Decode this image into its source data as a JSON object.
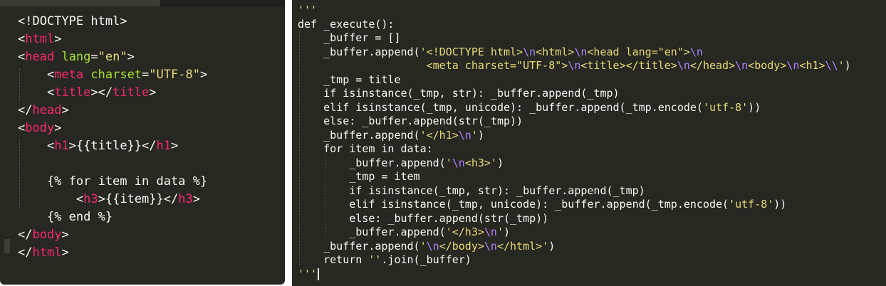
{
  "left_editor": {
    "lines": [
      [
        {
          "c": "p",
          "t": "<!DOCTYPE html>"
        }
      ],
      [
        {
          "c": "p",
          "t": "<"
        },
        {
          "c": "t",
          "t": "html"
        },
        {
          "c": "p",
          "t": ">"
        }
      ],
      [
        {
          "c": "p",
          "t": "<"
        },
        {
          "c": "t",
          "t": "head"
        },
        {
          "c": "p",
          "t": " "
        },
        {
          "c": "a",
          "t": "lang"
        },
        {
          "c": "p",
          "t": "="
        },
        {
          "c": "s",
          "t": "\"en\""
        },
        {
          "c": "p",
          "t": ">"
        }
      ],
      [
        {
          "c": "p",
          "t": "    <"
        },
        {
          "c": "t",
          "t": "meta"
        },
        {
          "c": "p",
          "t": " "
        },
        {
          "c": "a",
          "t": "charset"
        },
        {
          "c": "p",
          "t": "="
        },
        {
          "c": "s",
          "t": "\"UTF-8\""
        },
        {
          "c": "p",
          "t": ">"
        }
      ],
      [
        {
          "c": "p",
          "t": "    <"
        },
        {
          "c": "t",
          "t": "title"
        },
        {
          "c": "p",
          "t": "></"
        },
        {
          "c": "t",
          "t": "title"
        },
        {
          "c": "p",
          "t": ">"
        }
      ],
      [
        {
          "c": "p",
          "t": "</"
        },
        {
          "c": "t",
          "t": "head"
        },
        {
          "c": "p",
          "t": ">"
        }
      ],
      [
        {
          "c": "p",
          "t": "<"
        },
        {
          "c": "t",
          "t": "body"
        },
        {
          "c": "p",
          "t": ">"
        }
      ],
      [
        {
          "c": "p",
          "t": "    <"
        },
        {
          "c": "t",
          "t": "h1"
        },
        {
          "c": "p",
          "t": ">{{title}}</"
        },
        {
          "c": "t",
          "t": "h1"
        },
        {
          "c": "p",
          "t": ">"
        }
      ],
      [
        {
          "c": "p",
          "t": ""
        }
      ],
      [
        {
          "c": "p",
          "t": "    {% for item in data %}"
        }
      ],
      [
        {
          "c": "p",
          "t": "        <"
        },
        {
          "c": "t",
          "t": "h3"
        },
        {
          "c": "p",
          "t": ">{{item}}</"
        },
        {
          "c": "t",
          "t": "h3"
        },
        {
          "c": "p",
          "t": ">"
        }
      ],
      [
        {
          "c": "p",
          "t": "    {% end %}"
        }
      ],
      [
        {
          "c": "p",
          "t": "</"
        },
        {
          "c": "t",
          "t": "body"
        },
        {
          "c": "p",
          "t": ">"
        }
      ],
      [
        {
          "c": "p",
          "t": "</"
        },
        {
          "c": "t",
          "t": "html"
        },
        {
          "c": "p",
          "t": ">"
        }
      ]
    ]
  },
  "right_editor": {
    "lines": [
      [
        {
          "c": "s",
          "t": "'''"
        }
      ],
      [
        {
          "c": "p",
          "t": "def _execute():"
        }
      ],
      [
        {
          "c": "p",
          "t": "    _buffer = []"
        }
      ],
      [
        {
          "c": "p",
          "t": "    _buffer.append("
        },
        {
          "c": "s",
          "t": "'<!DOCTYPE html>"
        },
        {
          "c": "e",
          "t": "\\n"
        },
        {
          "c": "s",
          "t": "<html>"
        },
        {
          "c": "e",
          "t": "\\n"
        },
        {
          "c": "s",
          "t": "<head lang=\"en\">"
        },
        {
          "c": "e",
          "t": "\\n"
        }
      ],
      [
        {
          "c": "s",
          "t": "                    <meta charset=\"UTF-8\">"
        },
        {
          "c": "e",
          "t": "\\n"
        },
        {
          "c": "s",
          "t": "<title></title>"
        },
        {
          "c": "e",
          "t": "\\n"
        },
        {
          "c": "s",
          "t": "</head>"
        },
        {
          "c": "e",
          "t": "\\n"
        },
        {
          "c": "s",
          "t": "<body>"
        },
        {
          "c": "e",
          "t": "\\n"
        },
        {
          "c": "s",
          "t": "<h1>"
        },
        {
          "c": "e",
          "t": "\\\\"
        },
        {
          "c": "s",
          "t": "'"
        },
        {
          "c": "p",
          "t": ")"
        }
      ],
      [
        {
          "c": "p",
          "t": "    _tmp = title"
        }
      ],
      [
        {
          "c": "p",
          "t": "    if isinstance(_tmp, str): _buffer.append(_tmp)"
        }
      ],
      [
        {
          "c": "p",
          "t": "    elif isinstance(_tmp, unicode): _buffer.append(_tmp.encode("
        },
        {
          "c": "s",
          "t": "'utf-8'"
        },
        {
          "c": "p",
          "t": "))"
        }
      ],
      [
        {
          "c": "p",
          "t": "    else: _buffer.append(str(_tmp))"
        }
      ],
      [
        {
          "c": "p",
          "t": "    _buffer.append("
        },
        {
          "c": "s",
          "t": "'</h1>"
        },
        {
          "c": "e",
          "t": "\\n"
        },
        {
          "c": "s",
          "t": "'"
        },
        {
          "c": "p",
          "t": ")"
        }
      ],
      [
        {
          "c": "p",
          "t": "    for item in data:"
        }
      ],
      [
        {
          "c": "p",
          "t": "        _buffer.append("
        },
        {
          "c": "s",
          "t": "'"
        },
        {
          "c": "e",
          "t": "\\n"
        },
        {
          "c": "s",
          "t": "<h3>'"
        },
        {
          "c": "p",
          "t": ")"
        }
      ],
      [
        {
          "c": "p",
          "t": "        _tmp = item"
        }
      ],
      [
        {
          "c": "p",
          "t": "        if isinstance(_tmp, str): _buffer.append(_tmp)"
        }
      ],
      [
        {
          "c": "p",
          "t": "        elif isinstance(_tmp, unicode): _buffer.append(_tmp.encode("
        },
        {
          "c": "s",
          "t": "'utf-8'"
        },
        {
          "c": "p",
          "t": "))"
        }
      ],
      [
        {
          "c": "p",
          "t": "        else: _buffer.append(str(_tmp))"
        }
      ],
      [
        {
          "c": "p",
          "t": "        _buffer.append("
        },
        {
          "c": "s",
          "t": "'</h3>"
        },
        {
          "c": "e",
          "t": "\\n"
        },
        {
          "c": "s",
          "t": "'"
        },
        {
          "c": "p",
          "t": ")"
        }
      ],
      [
        {
          "c": "p",
          "t": "    _buffer.append("
        },
        {
          "c": "s",
          "t": "'"
        },
        {
          "c": "e",
          "t": "\\n"
        },
        {
          "c": "s",
          "t": "</body>"
        },
        {
          "c": "e",
          "t": "\\n"
        },
        {
          "c": "s",
          "t": "</html>'"
        },
        {
          "c": "p",
          "t": ")"
        }
      ],
      [
        {
          "c": "p",
          "t": "    return "
        },
        {
          "c": "s",
          "t": "''"
        },
        {
          "c": "p",
          "t": ".join(_buffer)"
        }
      ],
      [
        {
          "c": "s",
          "t": "'''"
        }
      ]
    ]
  },
  "colors": {
    "background": "#272822",
    "tag": "#f92672",
    "attribute": "#a6e22e",
    "string": "#e6db74",
    "escape": "#ae81ff",
    "text": "#f8f8f2"
  }
}
